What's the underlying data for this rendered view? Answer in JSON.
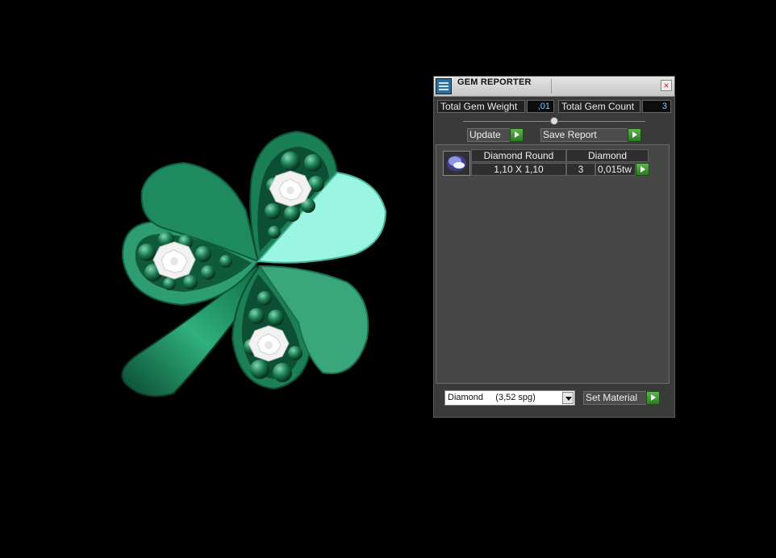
{
  "panel": {
    "title": "GEM REPORTER",
    "close_glyph": "×",
    "total_weight_label": "Total Gem Weight",
    "total_weight_value": ",01",
    "total_count_label": "Total Gem Count",
    "total_count_value": "3",
    "update_label": "Update",
    "save_label": "Save Report",
    "gems": [
      {
        "name": "Diamond Round",
        "size": "1,10 X 1,10",
        "material": "Diamond",
        "count": "3",
        "weight": "0,015tw"
      }
    ],
    "material_select_value": "Diamond     (3,52 spg)",
    "set_material_label": "Set Material"
  },
  "colors": {
    "background": "#000000",
    "leaf_dark": "#1f8a5f",
    "leaf_mid": "#3aa67c",
    "leaf_light": "#9af5e2",
    "accent_green": "#3fae30",
    "value_blue": "#7ec8ff"
  },
  "icons": {
    "app": "gem-reporter-app-icon",
    "close": "close-icon",
    "arrow": "play-arrow-icon",
    "gem": "round-gem-icon",
    "dropdown": "chevron-down-icon"
  }
}
